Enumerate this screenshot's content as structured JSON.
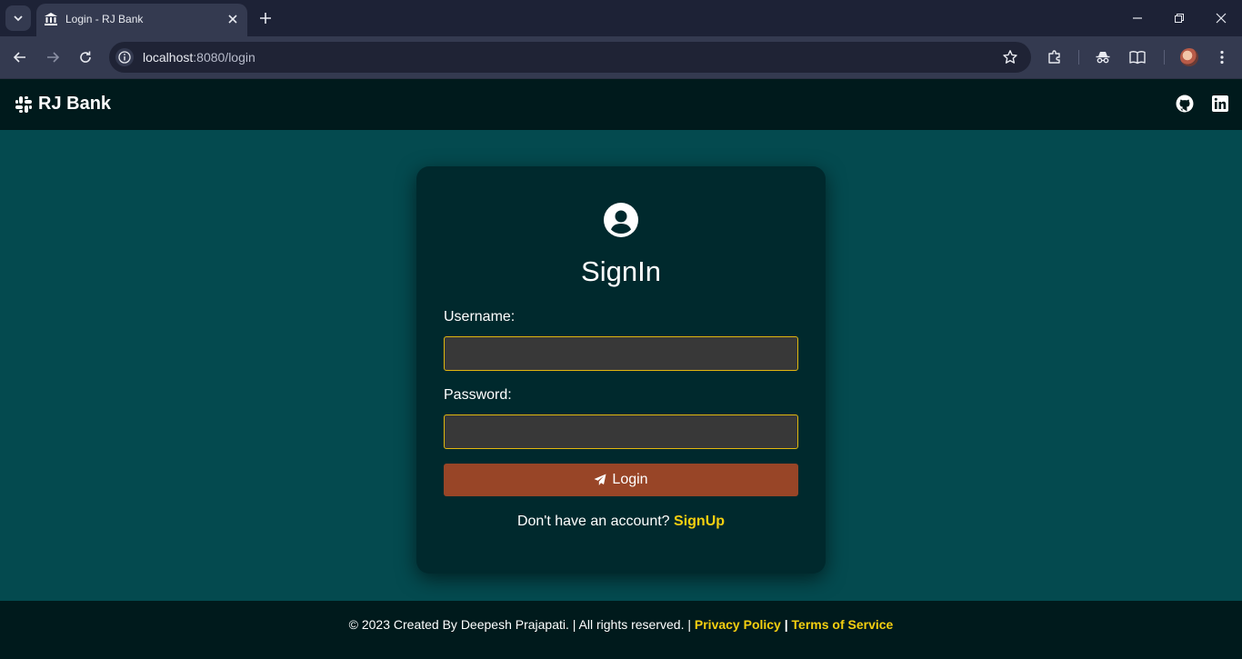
{
  "browser": {
    "tab_title": "Login - RJ Bank",
    "url_host": "localhost",
    "url_path": ":8080/login"
  },
  "navbar": {
    "brand": "RJ Bank"
  },
  "login_card": {
    "title": "SignIn",
    "username_label": "Username:",
    "username_value": "",
    "password_label": "Password:",
    "password_value": "",
    "login_button": "Login",
    "signup_prompt": "Don't have an account?",
    "signup_link": "SignUp"
  },
  "footer": {
    "copyright": "© 2023 Created By Deepesh Prajapati. | All rights reserved. |",
    "privacy": "Privacy Policy",
    "separator": "|",
    "terms": "Terms of Service"
  },
  "colors": {
    "page_bg": "#044a4f",
    "card_bg": "#00292d",
    "navbar_bg": "#001a1c",
    "accent_yellow": "#f5cf10",
    "button_bg": "#984527",
    "input_border": "#e3b70f"
  },
  "icons": {
    "tab_favicon": "bank-icon",
    "brand": "slack-like-hash-icon",
    "social": [
      "github-icon",
      "linkedin-icon"
    ],
    "card": "user-circle-icon",
    "login_button": "paper-plane-icon"
  }
}
